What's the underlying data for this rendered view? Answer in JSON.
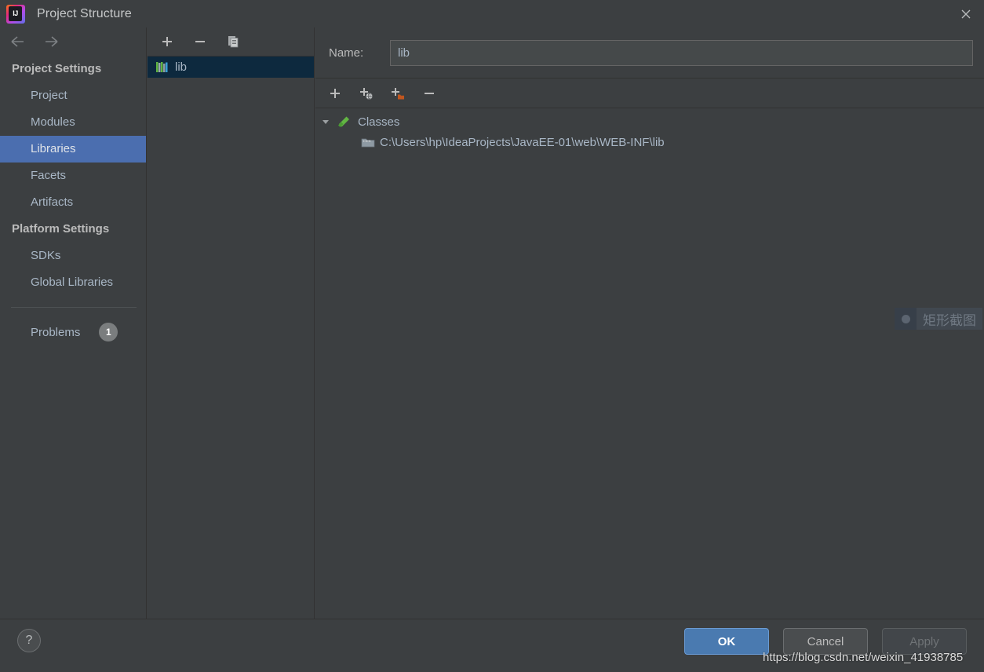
{
  "window": {
    "title": "Project Structure",
    "logo_text": "IJ",
    "logo_icon": "intellij-idea-logo",
    "close_icon": "close-icon"
  },
  "nav": {
    "back_icon": "arrow-left-icon",
    "forward_icon": "arrow-right-icon"
  },
  "sidebar": {
    "groups": [
      {
        "title": "Project Settings",
        "items": [
          {
            "label": "Project",
            "selected": false
          },
          {
            "label": "Modules",
            "selected": false
          },
          {
            "label": "Libraries",
            "selected": true
          },
          {
            "label": "Facets",
            "selected": false
          },
          {
            "label": "Artifacts",
            "selected": false
          }
        ]
      },
      {
        "title": "Platform Settings",
        "items": [
          {
            "label": "SDKs",
            "selected": false
          },
          {
            "label": "Global Libraries",
            "selected": false
          }
        ]
      }
    ],
    "problems": {
      "label": "Problems",
      "count": "1"
    }
  },
  "library_list": {
    "toolbar": [
      {
        "name": "add-library-button",
        "icon": "plus-icon"
      },
      {
        "name": "remove-library-button",
        "icon": "minus-icon"
      },
      {
        "name": "copy-library-button",
        "icon": "copy-icon"
      }
    ],
    "items": [
      {
        "label": "lib",
        "icon": "library-books-icon",
        "selected": true
      }
    ]
  },
  "detail": {
    "name_label": "Name:",
    "name_value": "lib",
    "name_placeholder": "",
    "toolbar": [
      {
        "name": "add-root-button",
        "icon": "plus-icon"
      },
      {
        "name": "add-from-maven-button",
        "icon": "plus-globe-icon"
      },
      {
        "name": "add-from-module-button",
        "icon": "plus-folder-icon"
      },
      {
        "name": "remove-root-button",
        "icon": "minus-icon"
      }
    ],
    "tree": [
      {
        "label": "Classes",
        "icon": "classes-hammer-icon",
        "expanded": true,
        "toggle_icon": "triangle-down-icon"
      },
      {
        "label": "C:\\Users\\hp\\IdeaProjects\\JavaEE-01\\web\\WEB-INF\\lib",
        "icon": "archive-folder-icon"
      }
    ]
  },
  "footer": {
    "help_label": "?",
    "help_icon": "help-icon",
    "buttons": [
      {
        "label": "OK",
        "name": "ok-button",
        "state": "default"
      },
      {
        "label": "Cancel",
        "name": "cancel-button",
        "state": "normal"
      },
      {
        "label": "Apply",
        "name": "apply-button",
        "state": "disabled"
      }
    ]
  },
  "overlays": {
    "snipping_tool": {
      "label": "矩形截图",
      "icon": "record-dot-icon"
    },
    "watermark": "https://blog.csdn.net/weixin_41938785"
  },
  "colors": {
    "background": "#3c3f41",
    "selection_blue": "#4b6eaf",
    "list_selection": "#0d293e",
    "text": "#a9b7c6",
    "ok_button": "#4a7ab0"
  }
}
